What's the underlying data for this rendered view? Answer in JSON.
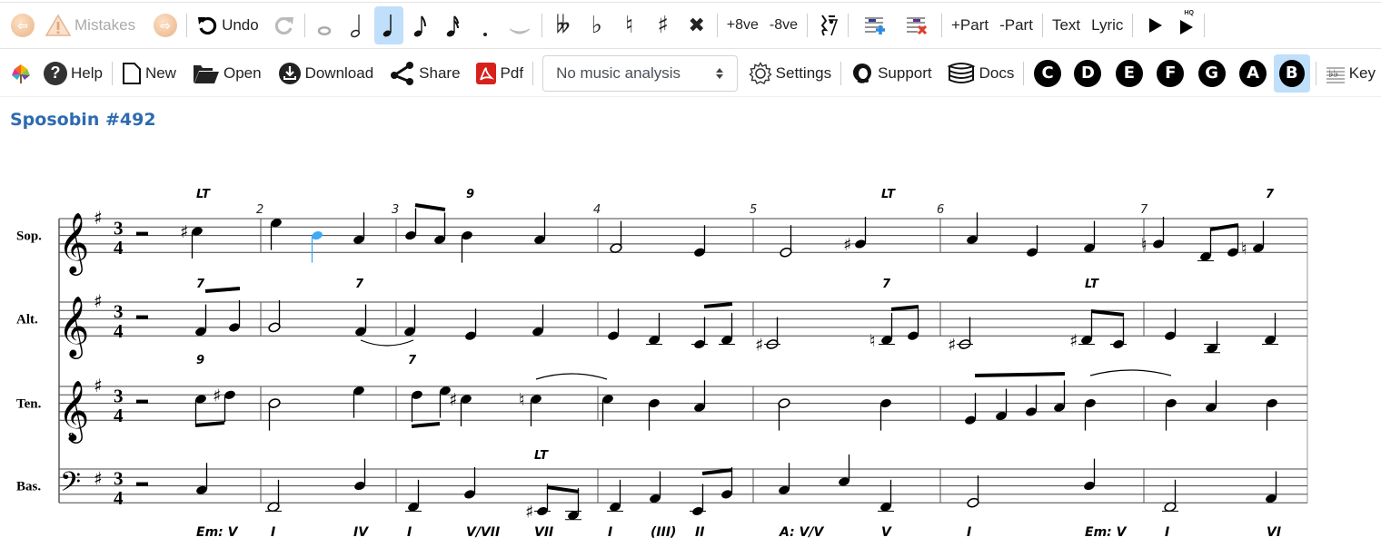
{
  "toolbar_top": {
    "back": {
      "icon": "arrow-left-icon"
    },
    "mistakes": {
      "icon": "warning-icon",
      "label": "Mistakes"
    },
    "forward": {
      "icon": "arrow-right-icon"
    },
    "undo": {
      "icon": "undo-icon",
      "label": "Undo"
    },
    "redo": {
      "icon": "redo-icon"
    },
    "durations": [
      {
        "name": "whole-note",
        "glyph": "𝅝",
        "active": false,
        "disabled": true
      },
      {
        "name": "half-note",
        "glyph": "𝅗𝅥",
        "active": false
      },
      {
        "name": "quarter-note",
        "glyph": "♩",
        "active": true
      },
      {
        "name": "eighth-note",
        "glyph": "♪",
        "active": false
      },
      {
        "name": "sixteenth-note",
        "glyph": "𝅘𝅥𝅯",
        "active": false
      },
      {
        "name": "dot",
        "glyph": ".",
        "active": false
      },
      {
        "name": "tie",
        "glyph": "‿",
        "active": false,
        "disabled": true
      }
    ],
    "accidentals": [
      {
        "name": "double-flat",
        "glyph": "𝄫"
      },
      {
        "name": "flat",
        "glyph": "♭"
      },
      {
        "name": "natural",
        "glyph": "♮"
      },
      {
        "name": "sharp",
        "glyph": "♯"
      },
      {
        "name": "double-sharp",
        "glyph": "𝄪"
      }
    ],
    "octave_up": "+8ve",
    "octave_down": "-8ve",
    "rest": {
      "icon": "rest-icon"
    },
    "add_staff": {
      "icon": "add-staff-icon"
    },
    "remove_staff": {
      "icon": "remove-staff-icon"
    },
    "add_part": "+Part",
    "remove_part": "-Part",
    "text": "Text",
    "lyric": "Lyric",
    "play": {
      "icon": "play-icon"
    },
    "play_hq": {
      "icon": "play-hq-icon",
      "badge": "HQ"
    }
  },
  "toolbar_bottom": {
    "logo": {
      "icon": "logo-icon"
    },
    "help": "Help",
    "new": "New",
    "open": "Open",
    "download": "Download",
    "share": "Share",
    "pdf": "Pdf",
    "analysis_select": {
      "value": "No music analysis"
    },
    "settings": "Settings",
    "support": "Support",
    "docs": "Docs",
    "keys": [
      {
        "label": "C",
        "active": false
      },
      {
        "label": "D",
        "active": false
      },
      {
        "label": "E",
        "active": false
      },
      {
        "label": "F",
        "active": false
      },
      {
        "label": "G",
        "active": false
      },
      {
        "label": "A",
        "active": false
      },
      {
        "label": "B",
        "active": true
      }
    ],
    "key": "Key"
  },
  "score": {
    "title": "Sposobin #492",
    "time_signature": {
      "num": "3",
      "den": "4"
    },
    "key_signature": "1 sharp",
    "highlight_color": "#3fa9f5",
    "measure_numbers": [
      "2",
      "3",
      "4",
      "5",
      "6",
      "7"
    ],
    "parts": [
      {
        "name": "Sop.",
        "clef": "treble",
        "annotations": [
          {
            "text": "LT",
            "measure": 1
          },
          {
            "text": "9",
            "measure": 3
          },
          {
            "text": "LT",
            "measure": 5
          },
          {
            "text": "7",
            "measure": 7
          }
        ]
      },
      {
        "name": "Alt.",
        "clef": "treble",
        "annotations": [
          {
            "text": "7",
            "measure": 1
          },
          {
            "text": "7",
            "measure": 2
          },
          {
            "text": "7",
            "measure": 5
          },
          {
            "text": "LT",
            "measure": 6
          }
        ]
      },
      {
        "name": "Ten.",
        "clef": "treble-8vb",
        "annotations": [
          {
            "text": "9",
            "measure": 1
          },
          {
            "text": "7",
            "measure": 3
          }
        ]
      },
      {
        "name": "Bas.",
        "clef": "bass",
        "annotations": [
          {
            "text": "LT",
            "measure": 3
          }
        ]
      }
    ],
    "harmony": [
      "Em: V",
      "I",
      "IV",
      "I",
      "V/VII",
      "VII",
      "I",
      "(III)",
      "II",
      "A: V/V",
      "V",
      "I",
      "Em: V",
      "I",
      "VI"
    ],
    "clef_8": "8"
  }
}
